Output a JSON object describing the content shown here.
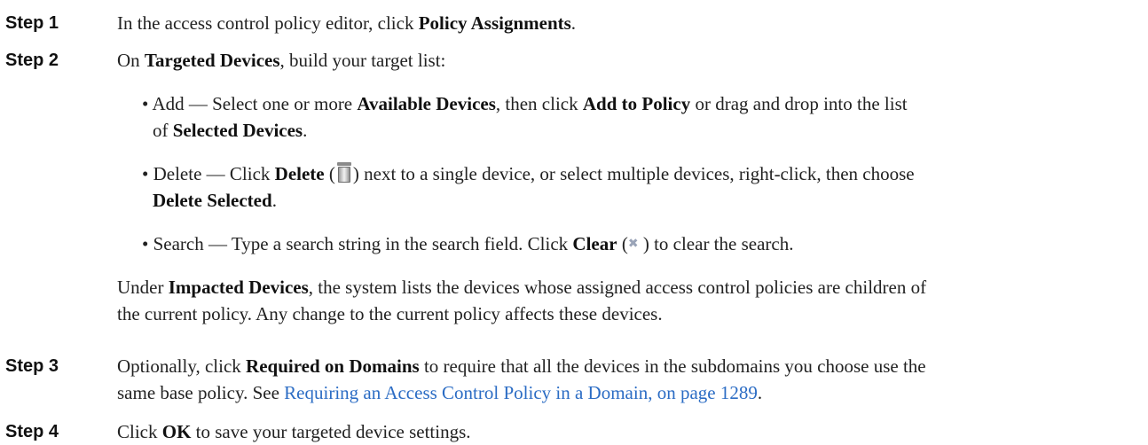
{
  "steps": [
    {
      "label": "Step 1",
      "text_pre": "In the access control policy editor, click ",
      "bold": "Policy Assignments",
      "text_post": "."
    },
    {
      "label": "Step 2",
      "text_pre": "On ",
      "bold": "Targeted Devices",
      "text_post": ", build your target list:",
      "bullets": {
        "add": {
          "pre": "• Add — Select one or more ",
          "b1": "Available Devices",
          "mid1": ", then click ",
          "b2": "Add to Policy",
          "mid2": " or drag and drop into the list",
          "line2_pre": "of ",
          "b3": "Selected Devices",
          "line2_post": "."
        },
        "delete": {
          "pre": "• Delete — Click ",
          "b1": "Delete",
          "paren_open": " (",
          "icon": "trash-icon",
          "paren_close": ")",
          "mid": " next to a single device, or select multiple devices, right-click, then choose",
          "b2": "Delete Selected",
          "post": "."
        },
        "search": {
          "pre": "• Search — Type a search string in the search field. Click ",
          "b1": "Clear",
          "paren_open": " (",
          "icon": "clear-x-icon",
          "paren_close": " )",
          "post": " to clear the search."
        }
      },
      "impacted": {
        "pre": "Under ",
        "bold": "Impacted Devices",
        "line1_post": ", the system lists the devices whose assigned access control policies are children of",
        "line2": "the current policy. Any change to the current policy affects these devices."
      }
    },
    {
      "label": "Step 3",
      "text_pre": "Optionally, click ",
      "bold": "Required on Domains",
      "line1_post": " to require that all the devices in the subdomains you choose use the",
      "line2_pre": "same base policy. See ",
      "link": "Requiring an Access Control Policy in a Domain, on page 1289",
      "line2_post": "."
    },
    {
      "label": "Step 4",
      "text_pre": "Click ",
      "bold": "OK",
      "text_post": " to save your targeted device settings."
    }
  ],
  "colors": {
    "link": "#2b6cc4",
    "text": "#222222"
  }
}
